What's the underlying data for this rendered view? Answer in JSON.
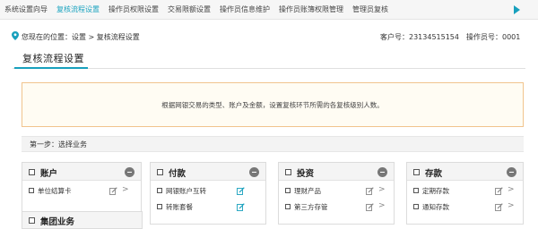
{
  "nav": {
    "tabs": [
      {
        "label": "系统设置向导"
      },
      {
        "label": "复核流程设置"
      },
      {
        "label": "操作员权限设置"
      },
      {
        "label": "交易限额设置"
      },
      {
        "label": "操作员信息维护"
      },
      {
        "label": "操作员账簿权限管理"
      },
      {
        "label": "管理员复核"
      }
    ],
    "active_index": 1,
    "accent": "#18a0bd"
  },
  "breadcrumb": {
    "text": "您现在的位置：设置 > 复核流程设置",
    "customer": "客户号：23134515154",
    "operator": "操作员号：0001"
  },
  "page": {
    "title": "复核流程设置"
  },
  "notice": {
    "text": "根据网银交易的类型、账户及金额，设置复核环节所需的各复核级别人数。"
  },
  "step": {
    "label": "第一步：选择业务"
  },
  "cards": [
    {
      "title": "账户",
      "items": [
        {
          "label": "单位结算卡",
          "edit_color": "#888888"
        }
      ]
    },
    {
      "title": "付款",
      "items": [
        {
          "label": "网银账户互转",
          "edit_color": "#18a0bd"
        },
        {
          "label": "转账套餐",
          "edit_color": "#18a0bd"
        }
      ]
    },
    {
      "title": "投资",
      "items": [
        {
          "label": "理财产品",
          "edit_color": "#888888"
        },
        {
          "label": "第三方存管",
          "edit_color": "#888888"
        }
      ]
    },
    {
      "title": "存款",
      "items": [
        {
          "label": "定期存款",
          "edit_color": "#888888"
        },
        {
          "label": "通知存款",
          "edit_color": "#888888"
        }
      ]
    }
  ],
  "partial_card": {
    "title": "集团业务"
  }
}
